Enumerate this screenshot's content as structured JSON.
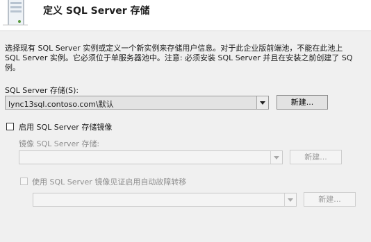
{
  "header": {
    "title": "定义 SQL Server 存储",
    "icon": "sql-store-icon"
  },
  "description": {
    "line1": "选择现有 SQL Server 实例或定义一个新实例来存储用户信息。对于此企业版前端池，不能在此池上",
    "line2": "SQL Server 实例。它必须位于单服务器池中。注意: 必须安装 SQL Server 并且在安装之前创建了 SQ",
    "line3": "例。"
  },
  "sql_store": {
    "label": "SQL Server 存储(S):",
    "selected_value": "lync13sql.contoso.com\\默认",
    "new_button": "新建..."
  },
  "mirroring": {
    "enable_checkbox_label": "启用 SQL Server 存储镜像",
    "enable_checked": false,
    "mirror_store_label": "镜像 SQL Server 存储:",
    "mirror_store_value": "",
    "mirror_new_button": "新建...",
    "witness_checkbox_label": "使用 SQL Server 镜像见证启用自动故障转移",
    "witness_checked": false,
    "witness_value": "",
    "witness_new_button": "新建..."
  },
  "colors": {
    "background": "#f0f0f0",
    "header_background": "#ffffff",
    "disabled_text": "#8f8f8f"
  }
}
